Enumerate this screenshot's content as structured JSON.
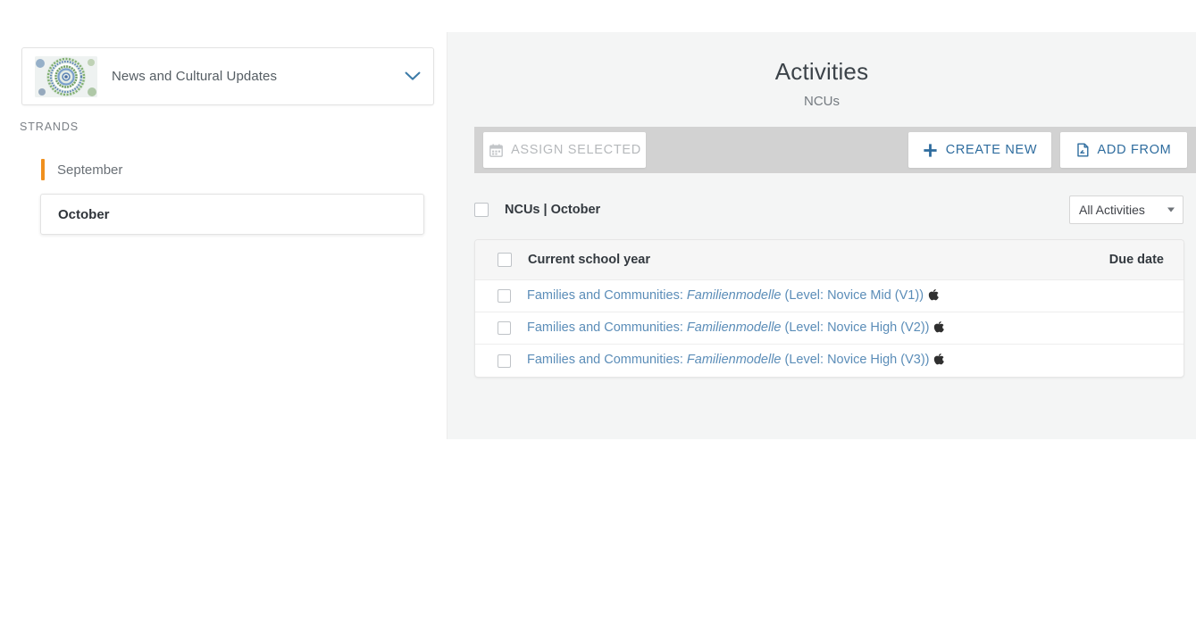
{
  "sidebar": {
    "unit": {
      "title": "News and Cultural Updates",
      "thumbnail_name": "mandala-thumbnail",
      "caret_icon": "chevron-down-icon"
    },
    "strands_label": "STRANDS",
    "strands": [
      {
        "label": "September",
        "selected": false,
        "indicator_color": "#f0901e"
      },
      {
        "label": "October",
        "selected": true
      }
    ]
  },
  "main": {
    "title": "Activities",
    "subtitle": "NCUs",
    "toolbar": {
      "assign_selected_label": "ASSIGN SELECTED",
      "assign_selected_icon": "calendar-icon",
      "assign_selected_disabled": true,
      "create_new_label": "CREATE NEW",
      "create_new_icon": "plus-icon",
      "add_from_label": "ADD FROM",
      "add_from_icon": "import-document-icon"
    },
    "filter": {
      "label": "NCUs | October",
      "select_value": "All Activities"
    },
    "table": {
      "columns": {
        "name": "Current school year",
        "due_date": "Due date"
      },
      "rows": [
        {
          "prefix": "Families and Communities: ",
          "italic": "Familienmodelle",
          "suffix": " (Level: Novice Mid (V1))",
          "badge_icon": "apple-icon",
          "due_date": ""
        },
        {
          "prefix": "Families and Communities: ",
          "italic": "Familienmodelle",
          "suffix": " (Level: Novice High (V2))",
          "badge_icon": "apple-icon",
          "due_date": ""
        },
        {
          "prefix": "Families and Communities: ",
          "italic": "Familienmodelle",
          "suffix": " (Level: Novice High (V3))",
          "badge_icon": "apple-icon",
          "due_date": ""
        }
      ]
    }
  },
  "colors": {
    "accent_blue": "#2e6c9e",
    "link_blue": "#5b8db8",
    "strand_indicator": "#f0901e",
    "toolbar_grey": "#d2d2d2",
    "panel_grey": "#f4f5f5"
  }
}
